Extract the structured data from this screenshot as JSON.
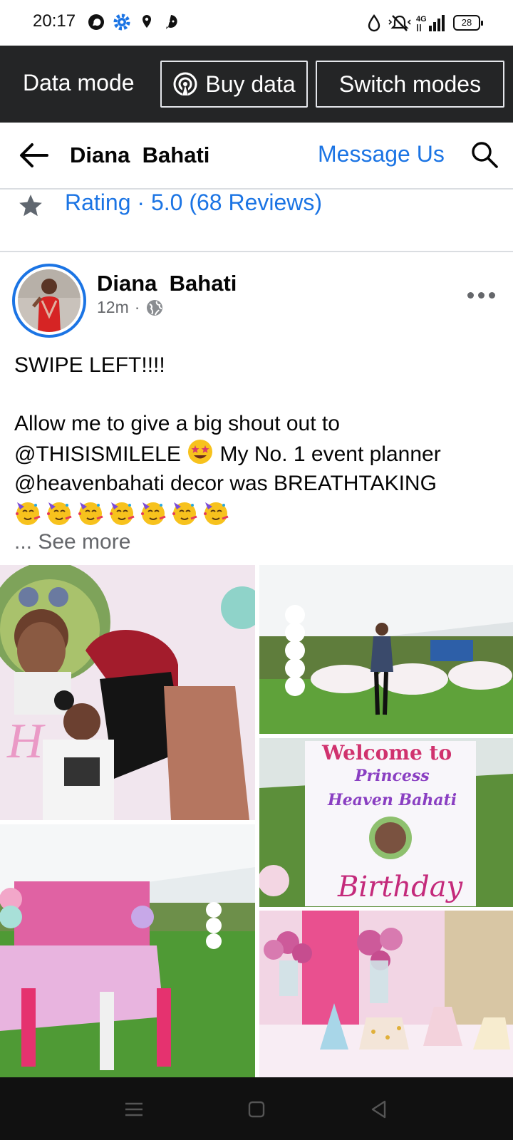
{
  "status_bar": {
    "time": "20:17",
    "battery": "28",
    "network": "4G"
  },
  "data_bar": {
    "label": "Data mode",
    "buy_label": "Buy data",
    "switch_label": "Switch modes"
  },
  "header": {
    "title": "Diana  Bahati",
    "message_label": "Message Us"
  },
  "rating": {
    "text": "Rating · 5.0 (68 Reviews)"
  },
  "post": {
    "author": "Diana  Bahati",
    "time": "12m",
    "separator": "·",
    "lines": [
      "SWIPE LEFT!!!!",
      "Allow me to give a big shout out to",
      "@THISISMILELE",
      " My No. 1 event planner",
      "@heavenbahati decor was BREATHTAKING"
    ],
    "see_more": "... See more",
    "photos": [
      {
        "name": "photo-mother-kissing-daughter",
        "overlay_text": "H"
      },
      {
        "name": "photo-woman-in-garden-tent",
        "overlay_text": ""
      },
      {
        "name": "photo-welcome-sign",
        "sign_line1": "Welcome to",
        "sign_line2": "Princess",
        "sign_line3": "Heaven Bahati",
        "sign_line4": "Birthday"
      },
      {
        "name": "photo-party-tables",
        "overlay_text": ""
      },
      {
        "name": "photo-table-decor",
        "overlay_text": ""
      }
    ]
  },
  "colors": {
    "accent": "#1b74e4",
    "data_bar_bg": "#242526",
    "secondary_text": "#65676b",
    "nav_bar_bg": "#111111"
  },
  "icons": [
    "whatsapp-icon",
    "settings-icon",
    "location-icon",
    "chat-icon",
    "water-icon",
    "mute-icon",
    "signal-icon",
    "battery-icon",
    "broadcast-icon",
    "back-arrow-icon",
    "search-icon",
    "star-icon",
    "globe-icon",
    "more-icon",
    "menu-icon",
    "home-icon",
    "back-icon"
  ]
}
